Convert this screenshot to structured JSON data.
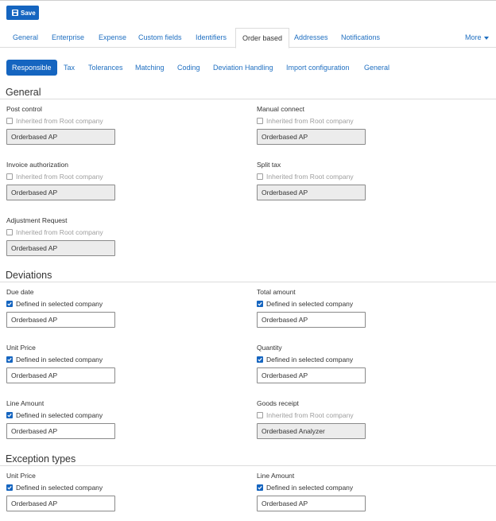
{
  "toolbar": {
    "save_label": "Save"
  },
  "tabs": [
    {
      "label": "General"
    },
    {
      "label": "Enterprise"
    },
    {
      "label": "Expense"
    },
    {
      "label": "Custom fields"
    },
    {
      "label": "Identifiers"
    },
    {
      "label": "Order based",
      "active": true
    },
    {
      "label": "Addresses"
    },
    {
      "label": "Notifications"
    }
  ],
  "more_label": "More",
  "subtabs": [
    {
      "label": "Responsible",
      "active": true
    },
    {
      "label": "Tax"
    },
    {
      "label": "Tolerances"
    },
    {
      "label": "Matching"
    },
    {
      "label": "Coding"
    },
    {
      "label": "Deviation Handling"
    },
    {
      "label": "Import configuration"
    },
    {
      "label": "General"
    }
  ],
  "sections": {
    "general": {
      "title": "General",
      "fields": [
        {
          "label": "Post control",
          "check_label": "Inherited from Root company",
          "checked": false,
          "value": "Orderbased AP",
          "disabled": true
        },
        {
          "label": "Manual connect",
          "check_label": "Inherited from Root company",
          "checked": false,
          "value": "Orderbased AP",
          "disabled": true
        },
        {
          "label": "Invoice authorization",
          "check_label": "Inherited from Root company",
          "checked": false,
          "value": "Orderbased AP",
          "disabled": true
        },
        {
          "label": "Split tax",
          "check_label": "Inherited from Root company",
          "checked": false,
          "value": "Orderbased AP",
          "disabled": true
        },
        {
          "label": "Adjustment Request",
          "check_label": "Inherited from Root company",
          "checked": false,
          "value": "Orderbased AP",
          "disabled": true
        }
      ]
    },
    "deviations": {
      "title": "Deviations",
      "fields": [
        {
          "label": "Due date",
          "check_label": "Defined in selected company",
          "checked": true,
          "value": "Orderbased AP",
          "disabled": false
        },
        {
          "label": "Total amount",
          "check_label": "Defined in selected company",
          "checked": true,
          "value": "Orderbased AP",
          "disabled": false
        },
        {
          "label": "Unit Price",
          "check_label": "Defined in selected company",
          "checked": true,
          "value": "Orderbased AP",
          "disabled": false
        },
        {
          "label": "Quantity",
          "check_label": "Defined in selected company",
          "checked": true,
          "value": "Orderbased AP",
          "disabled": false
        },
        {
          "label": "Line Amount",
          "check_label": "Defined in selected company",
          "checked": true,
          "value": "Orderbased AP",
          "disabled": false
        },
        {
          "label": "Goods receipt",
          "check_label": "Inherited from Root company",
          "checked": false,
          "value": "Orderbased Analyzer",
          "disabled": true
        }
      ]
    },
    "exception_types": {
      "title": "Exception types",
      "fields": [
        {
          "label": "Unit Price",
          "check_label": "Defined in selected company",
          "checked": true,
          "value": "Orderbased AP",
          "disabled": false
        },
        {
          "label": "Line Amount",
          "check_label": "Defined in selected company",
          "checked": true,
          "value": "Orderbased AP",
          "disabled": false
        }
      ]
    }
  }
}
